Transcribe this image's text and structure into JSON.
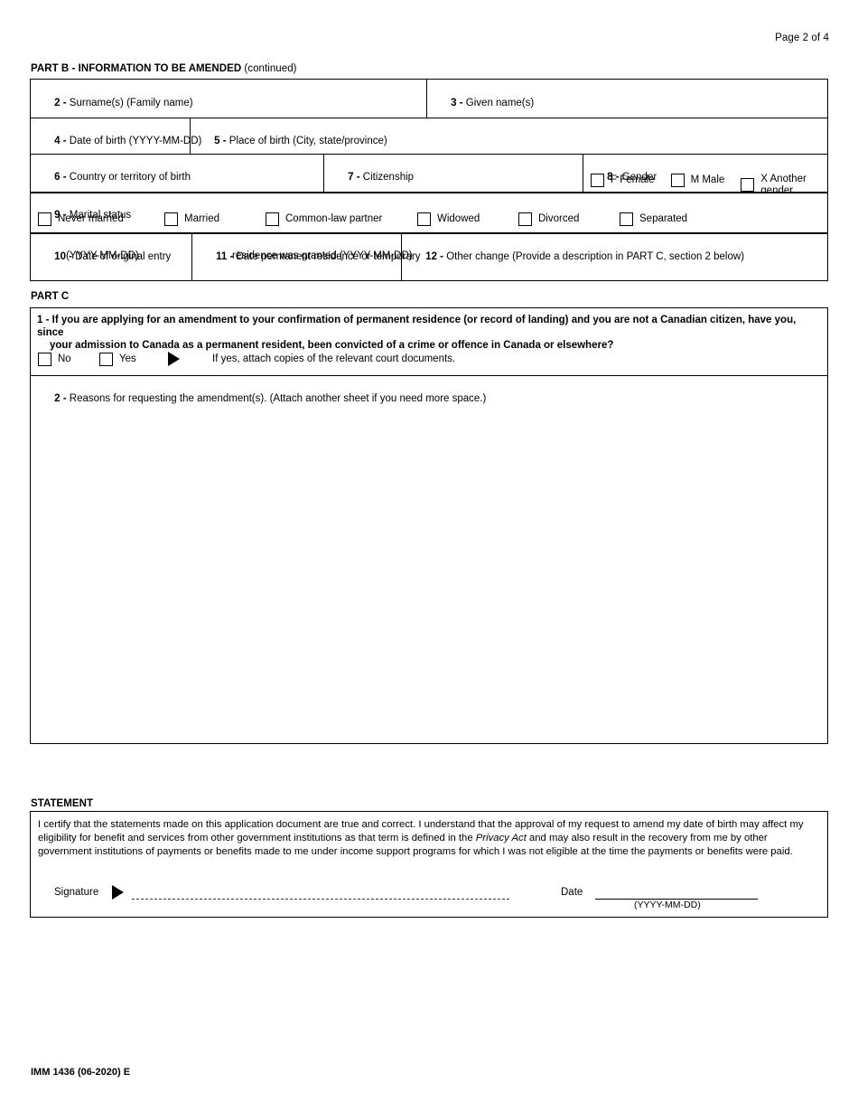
{
  "header": {
    "page_indicator": "Page 2 of 4"
  },
  "part_b": {
    "heading_bold": "PART B - INFORMATION TO BE AMENDED",
    "heading_rest": " (continued)",
    "fields": {
      "f2_num": "2 - ",
      "f2_label": "Surname(s) (Family name)",
      "f3_num": "3 - ",
      "f3_label": "Given name(s)",
      "f4_num": "4 - ",
      "f4_label": "Date of birth (YYYY-MM-DD)",
      "f5_num": "5 - ",
      "f5_label": "Place of birth (City, state/province)",
      "f6_num": "6 - ",
      "f6_label": "Country or territory of birth",
      "f7_num": "7 - ",
      "f7_label": "Citizenship",
      "f8_num": "8 - ",
      "f8_label": "Gender",
      "f9_num": "9 - ",
      "f9_label": "Marital status",
      "f10_num": "10 - ",
      "f10_label_line1": "Date of original entry",
      "f10_label_line2": "(YYYY-MM-DD)",
      "f11_num": "11 - ",
      "f11_label_line1": "Date permanent residence or temporary",
      "f11_label_line2": "residence was granted (YYYY-MM-DD)",
      "f12_num": "12 - ",
      "f12_label": "Other change (Provide a description in PART C, section 2 below)"
    },
    "gender_options": [
      {
        "label": "F Female"
      },
      {
        "label": "M Male"
      },
      {
        "label": "X Another\ngender"
      }
    ],
    "marital_options": [
      {
        "label": "Never married"
      },
      {
        "label": "Married"
      },
      {
        "label": "Common-law partner"
      },
      {
        "label": "Widowed"
      },
      {
        "label": "Divorced"
      },
      {
        "label": "Separated"
      }
    ]
  },
  "part_c": {
    "heading": "PART C",
    "q1_num": "1 - ",
    "q1_line1": "If you are applying for an amendment to your confirmation of permanent residence (or record of landing) and you are not a Canadian citizen, have you, since",
    "q1_line2": "your admission to Canada as a permanent resident, been convicted of a crime or offence in Canada or elsewhere?",
    "q1_options": [
      {
        "label": "No"
      },
      {
        "label": "Yes"
      }
    ],
    "q1_note": "If yes, attach copies of the relevant court documents.",
    "q2_num": "2 - ",
    "q2_label": "Reasons for requesting the amendment(s). (Attach another sheet if you need more space.)"
  },
  "statement": {
    "heading": "STATEMENT",
    "body_part1": "I certify that the statements made on this application document are true and correct. I understand that the approval of my request to amend my date of birth may affect my eligibility for benefit and services from other government institutions as that term is defined in the ",
    "body_italic": "Privacy Act",
    "body_part2": " and may also result in the recovery from me by other government institutions of payments or benefits made to me under income support programs for which I was not eligible at the time the payments or benefits were paid.",
    "signature_label": "Signature",
    "date_label": "Date",
    "date_hint": "(YYYY-MM-DD)"
  },
  "footer": {
    "form_code": "IMM 1436 (06-2020) E"
  }
}
